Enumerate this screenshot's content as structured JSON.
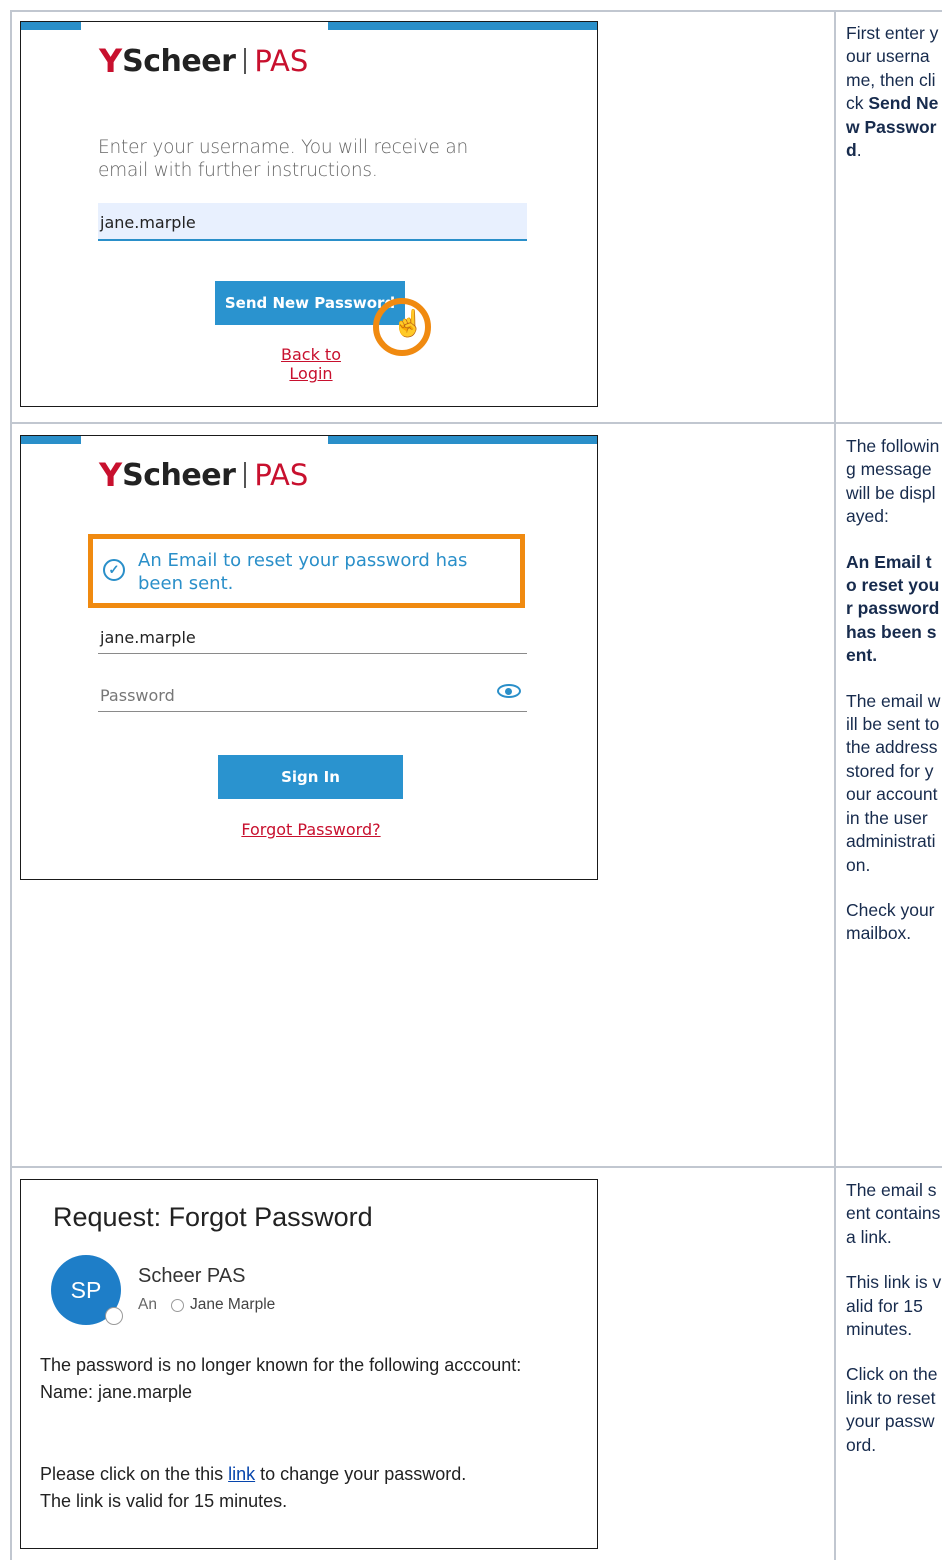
{
  "step1": {
    "logo": {
      "brand": "Scheer",
      "product": "PAS"
    },
    "instructions": "Enter your username. You will receive an email with further instructions.",
    "username_value": "jane.marple",
    "send_button": "Send New Password",
    "back_link": "Back to Login",
    "description": {
      "before": "First enter your username, then click ",
      "bold": "Send New Password",
      "after": "."
    }
  },
  "step2": {
    "logo": {
      "brand": "Scheer",
      "product": "PAS"
    },
    "success_message": "An Email to reset your password has been sent.",
    "username_value": "jane.marple",
    "password_placeholder": "Password",
    "sign_in_button": "Sign In",
    "forgot_link": "Forgot Password?",
    "description": {
      "p1": "The following message will be displayed:",
      "p2_bold": "An Email to reset your password has been sent.",
      "p3": "The email will be sent to the address stored for your account in the user administration.",
      "p4": "Check your mailbox."
    }
  },
  "step3": {
    "email_subject": "Request: Forgot Password",
    "avatar_initials": "SP",
    "sender_name": "Scheer PAS",
    "to_label": "An",
    "recipient": "Jane Marple",
    "body_line1": "The password is no longer known for the following acccount:",
    "body_line2": "Name: jane.marple",
    "body_line3_before": "Please click on the this ",
    "body_line3_link": "link",
    "body_line3_after": " to change your password.",
    "body_line4": "The link is valid for 15 minutes.",
    "description": {
      "p1": "The email sent contains a link.",
      "p2": "This link is valid for 15 minutes.",
      "p3": "Click on the link to reset your password."
    }
  },
  "icons": {
    "logo_mark": "scheer-logo-icon",
    "hand_cursor": "hand-pointer-icon",
    "check": "check-circle-icon",
    "eye": "eye-icon"
  },
  "colors": {
    "accent_blue": "#2a93cf",
    "brand_red": "#c8102e",
    "highlight_orange": "#f08a10"
  }
}
